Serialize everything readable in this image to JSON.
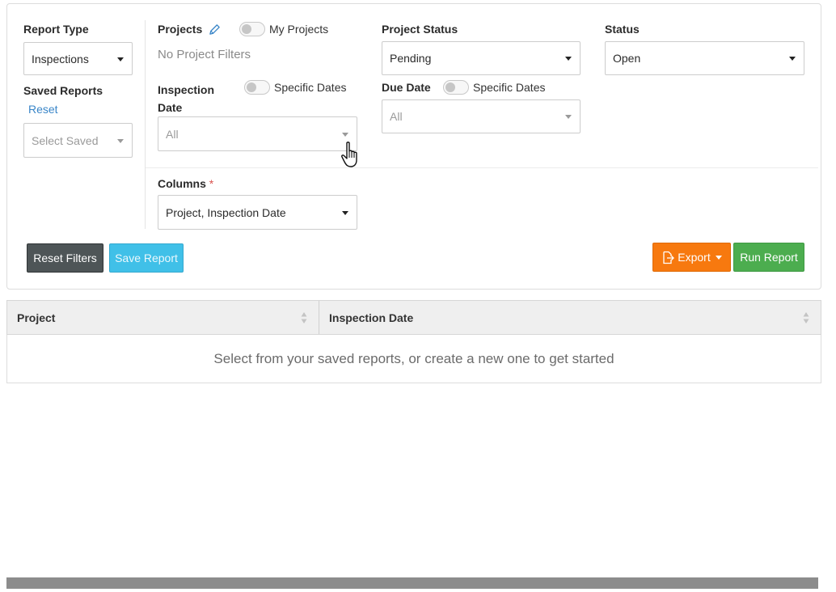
{
  "filters": {
    "report_type": {
      "label": "Report Type",
      "value": "Inspections"
    },
    "saved_reports": {
      "label": "Saved Reports",
      "reset_link": "Reset",
      "placeholder": "Select Saved"
    },
    "projects": {
      "label": "Projects",
      "toggle_label": "My Projects",
      "empty_text": "No Project Filters"
    },
    "inspection_date": {
      "label": "Inspection Date",
      "toggle_label": "Specific Dates",
      "value": "All"
    },
    "project_status": {
      "label": "Project Status",
      "value": "Pending"
    },
    "due_date": {
      "label": "Due Date",
      "toggle_label": "Specific Dates",
      "value": "All"
    },
    "status": {
      "label": "Status",
      "value": "Open"
    },
    "columns": {
      "label": "Columns",
      "required_mark": "*",
      "value": "Project, Inspection Date"
    }
  },
  "buttons": {
    "reset_filters": "Reset Filters",
    "save_report": "Save Report",
    "export": "Export",
    "run_report": "Run Report"
  },
  "table": {
    "columns": [
      "Project",
      "Inspection Date"
    ],
    "empty_message": "Select from your saved reports, or create a new one to get started"
  },
  "icons": {
    "edit": "pencil-icon",
    "export": "file-export-icon",
    "cursor": "hand-pointer-icon"
  },
  "colors": {
    "accent_link": "#3a86c8",
    "export": "#f7790f",
    "run": "#4cad4f",
    "save": "#40c0e8",
    "reset": "#4e5557",
    "required": "#d9534f"
  }
}
